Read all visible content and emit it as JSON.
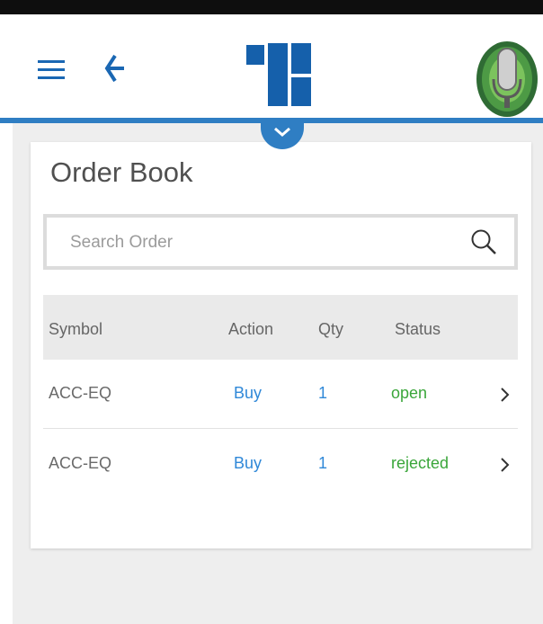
{
  "header": {
    "menu_icon": "hamburger-icon",
    "back_icon": "back-arrow-icon",
    "logo_icon": "brand-logo",
    "avatar_icon": "microphone-avatar",
    "expand_icon": "chevron-down-icon",
    "accent_color": "#2f7ec3"
  },
  "order_book": {
    "title": "Order Book",
    "search": {
      "placeholder": "Search Order",
      "value": ""
    },
    "columns": {
      "symbol": "Symbol",
      "action": "Action",
      "qty": "Qty",
      "status": "Status"
    },
    "rows": [
      {
        "symbol": "ACC-EQ",
        "action": "Buy",
        "qty": "1",
        "status": "open"
      },
      {
        "symbol": "ACC-EQ",
        "action": "Buy",
        "qty": "1",
        "status": "rejected"
      }
    ],
    "colors": {
      "link": "#2f88d8",
      "status": "#3aa63a"
    }
  }
}
